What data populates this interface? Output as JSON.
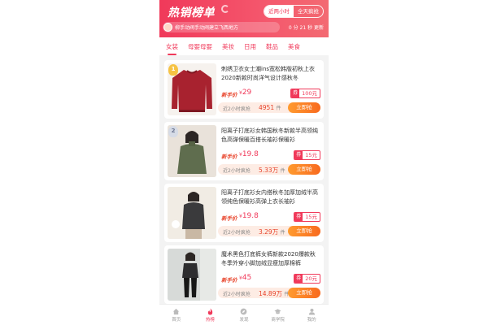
{
  "header": {
    "title": "热销榜单",
    "segments": [
      "近两小时",
      "全天疯抢"
    ],
    "ticker_text": "柳手动阀手动阀建立飞西地方",
    "countdown": "0 分 21 秒 更新"
  },
  "tabs": [
    "女装",
    "母婴母婴",
    "美妆",
    "日用",
    "鞋品",
    "美食"
  ],
  "labels": {
    "newbie": "新手价",
    "currency": "¥",
    "coupon_tag": "券",
    "sales_label": "近2小时疯抢",
    "sales_unit": "件",
    "buy": "立即抢"
  },
  "products": [
    {
      "rank": "1",
      "title": "刺绣卫衣女士潮ins宽松韩版初秋上衣2020新款时尚洋气设计感秋冬",
      "price": "29",
      "coupon": "100元",
      "sales": "4951"
    },
    {
      "rank": "2",
      "title": "阳离子打底衫女韩国秋冬新款半高领纯色高弹保暖百搭长袖衫保暖衫",
      "price": "19.8",
      "coupon": "15元",
      "sales": "5.33万"
    },
    {
      "rank": "",
      "title": "阳离子打底衫女内搭秋冬加厚加绒半高领纯色保暖衫高弹上衣长袖衫",
      "price": "19.8",
      "coupon": "15元",
      "sales": "3.29万"
    },
    {
      "rank": "",
      "title": "魔术黑色打底裤女裤新款2020爆款秋冬季外穿小脚加绒显瘦加厚棉裤",
      "price": "45",
      "coupon": "20元",
      "sales": "14.89万"
    }
  ],
  "bottom_nav": [
    {
      "label": "首页",
      "icon": "home-icon"
    },
    {
      "label": "热榜",
      "icon": "flame-icon"
    },
    {
      "label": "发现",
      "icon": "compass-icon"
    },
    {
      "label": "商学院",
      "icon": "graduation-cap-icon"
    },
    {
      "label": "我的",
      "icon": "user-icon"
    }
  ],
  "colors": {
    "accent": "#f0395a",
    "buy": "#f86a1f"
  }
}
